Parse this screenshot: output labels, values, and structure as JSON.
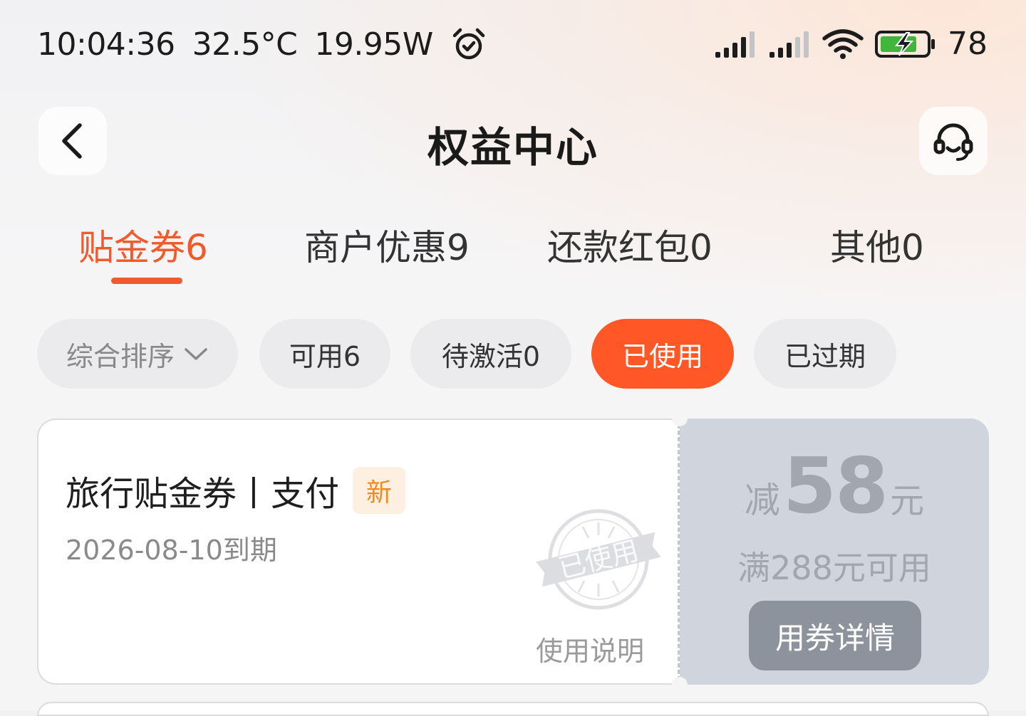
{
  "status_bar": {
    "time": "10:04:36",
    "temperature": "32.5°C",
    "power": "19.95W",
    "battery": "78"
  },
  "header": {
    "title": "权益中心"
  },
  "tabs": [
    {
      "label": "贴金券6",
      "active": true
    },
    {
      "label": "商户优惠9",
      "active": false
    },
    {
      "label": "还款红包0",
      "active": false
    },
    {
      "label": "其他0",
      "active": false
    }
  ],
  "filters": {
    "sort_label": "综合排序",
    "chips": [
      {
        "label": "可用6",
        "active": false
      },
      {
        "label": "待激活0",
        "active": false
      },
      {
        "label": "已使用",
        "active": true
      },
      {
        "label": "已过期",
        "active": false
      }
    ]
  },
  "coupon": {
    "title": "旅行贴金券丨支付",
    "badge": "新",
    "expiry": "2026-08-10到期",
    "stamp": "已使用",
    "usage_link": "使用说明",
    "amount_prefix": "减",
    "amount_value": "58",
    "amount_suffix": "元",
    "threshold": "满288元可用",
    "detail_button": "用券详情"
  },
  "colors": {
    "accent": "#f15a2b",
    "chip_active": "#ff5726",
    "badge_text": "#f08a23",
    "used_panel": "#d0d4dc"
  }
}
